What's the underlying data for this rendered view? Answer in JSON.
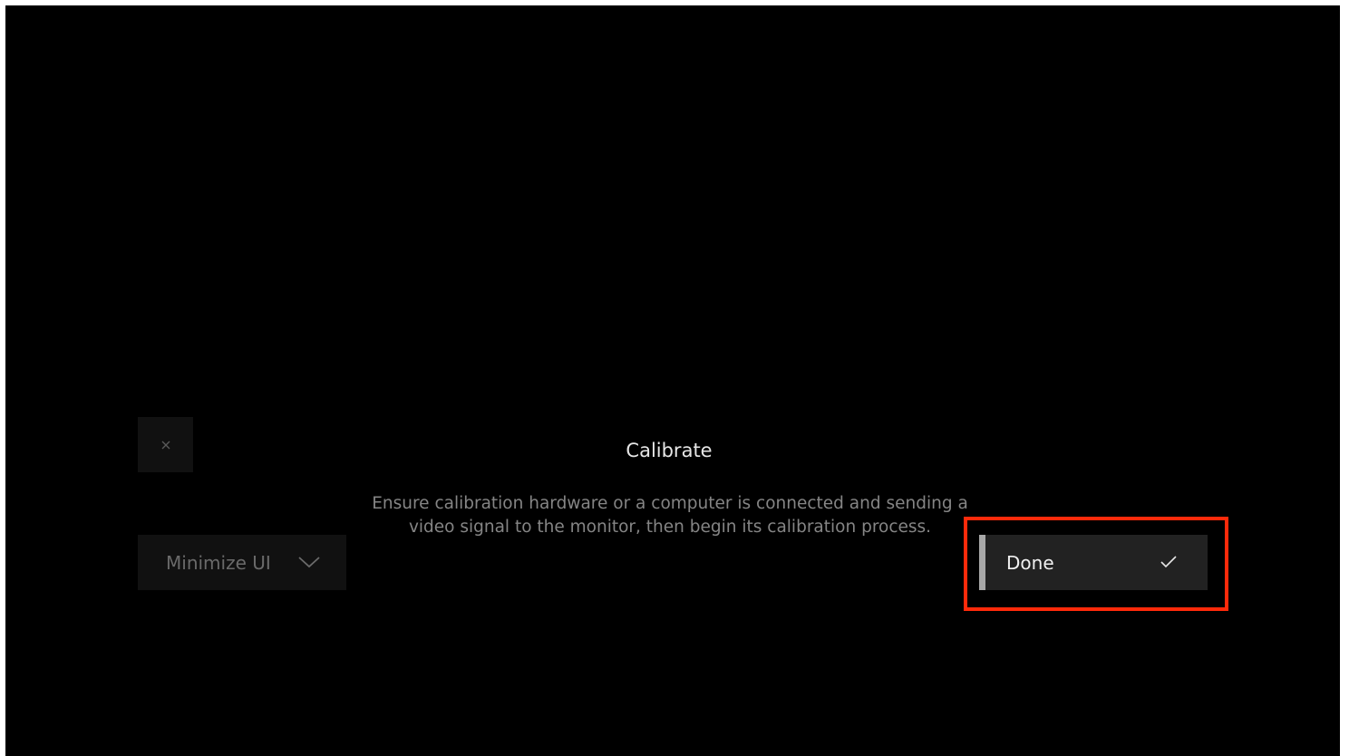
{
  "dialog": {
    "title": "Calibrate",
    "description": "Ensure calibration hardware or a computer is connected and sending a video signal to the monitor, then begin its calibration process."
  },
  "controls": {
    "close_icon": "close-icon",
    "minimize_label": "Minimize UI",
    "minimize_icon": "chevron-down-icon",
    "done_label": "Done",
    "done_icon": "checkmark-icon"
  },
  "colors": {
    "background": "#000000",
    "button_bg": "#111111",
    "done_bg": "#222222",
    "done_accent": "#a8a8a8",
    "highlight": "#ff2a0a"
  }
}
